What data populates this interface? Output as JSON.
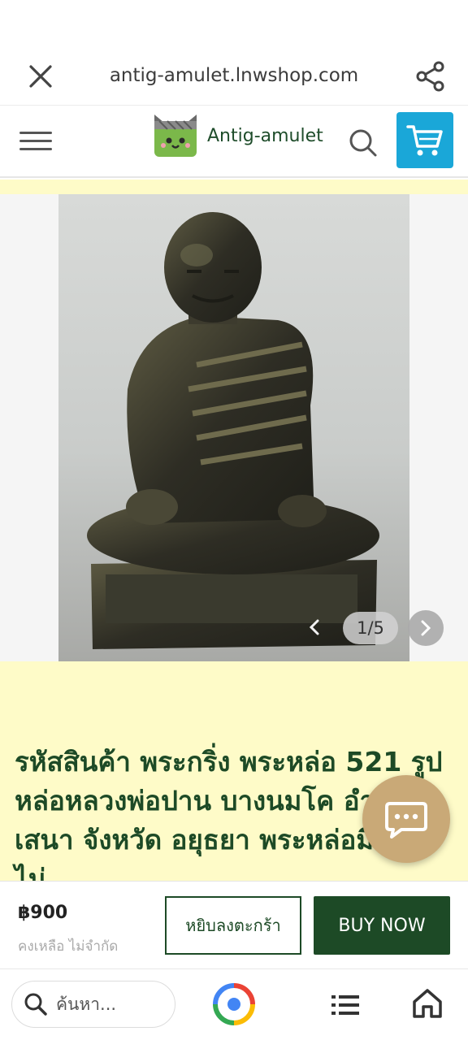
{
  "browser": {
    "url": "antig-amulet.lnwshop.com"
  },
  "header": {
    "brand_name": "Antig-amulet"
  },
  "gallery": {
    "counter": "1/5"
  },
  "product": {
    "title": "รหัสสินค้า พระกริ่ง พระหล่อ 521 รูปหล่อหลวงพ่อปาน บางนมโค อำเภอเสนา จังหวัด อยุธยา พระหล่อมีอายุ ไม่"
  },
  "purchase": {
    "price": "฿900",
    "stock": "คงเหลือ ไม่จำกัด",
    "add_to_cart_label": "หยิบลงตะกร้า",
    "buy_now_label": "BUY NOW"
  },
  "bottom_nav": {
    "search_placeholder": "ค้นหา..."
  },
  "colors": {
    "brand_green": "#1d4a26",
    "cart_blue": "#1aa7d8",
    "cream": "#fefbc8",
    "chat_tan": "#c9a977"
  },
  "icons": [
    "close-icon",
    "share-icon",
    "menu-icon",
    "search-icon",
    "cart-icon",
    "chevron-left-icon",
    "chevron-right-icon",
    "chat-icon",
    "lens-icon",
    "tabs-icon",
    "home-icon"
  ]
}
